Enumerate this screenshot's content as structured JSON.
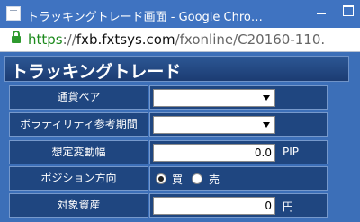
{
  "window": {
    "title": "トラッキングトレード画面 - Google Chro…"
  },
  "address_bar": {
    "scheme": "https",
    "separator": "://",
    "host": "fxb.fxtsys.com",
    "path": "/fxonline/C20160-110."
  },
  "page": {
    "title": "トラッキングトレード"
  },
  "form": {
    "currency_pair": {
      "label": "通貨ペア",
      "value": ""
    },
    "volatility_period": {
      "label": "ボラティリティ参考期間",
      "value": ""
    },
    "assumed_range": {
      "label": "想定変動幅",
      "value": "0.0",
      "unit": "PIP"
    },
    "position_direction": {
      "label": "ポジション方向",
      "buy_label": "買",
      "sell_label": "売",
      "selected": "buy"
    },
    "target_asset": {
      "label": "対象資産",
      "value": "0",
      "unit": "円"
    }
  },
  "colors": {
    "title_bar": "#3f73c1",
    "page_background": "#3c6fb8",
    "cell_background": "#1f4680",
    "header_background": "#1c3c72",
    "url_secure": "#1d8a1d"
  },
  "icons": {
    "app": "page-icon",
    "lock": "lock-icon",
    "minimize": "minimize-icon",
    "maximize": "maximize-icon",
    "dropdown": "caret-down-icon"
  }
}
